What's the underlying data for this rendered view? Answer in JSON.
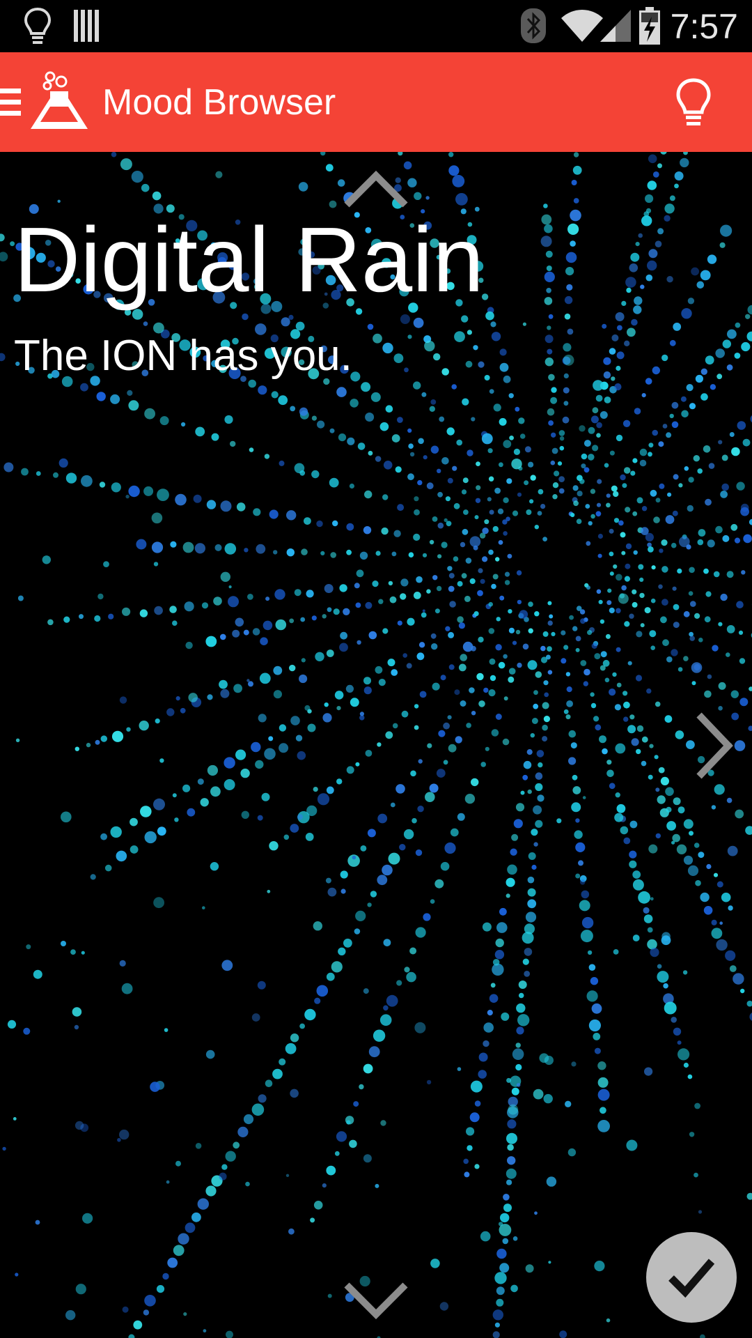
{
  "status_bar": {
    "time": "7:57",
    "icons": [
      "lightbulb-icon",
      "barcode-icon",
      "bluetooth-icon",
      "wifi-icon",
      "signal-icon",
      "battery-charging-icon"
    ]
  },
  "app_bar": {
    "title": "Mood Browser",
    "menu_icon": "hamburger-menu-icon",
    "logo_icon": "flask-logo-icon",
    "action_icon": "lightbulb-icon"
  },
  "mood": {
    "title": "Digital Rain",
    "subtitle": "The ION has you.",
    "background": "cyan-particle-starburst",
    "dot_color": "#22d3e6"
  },
  "navigation": {
    "up_icon": "chevron-up-icon",
    "down_icon": "chevron-down-icon",
    "next_icon": "chevron-right-icon"
  },
  "confirm": {
    "icon": "checkmark-icon",
    "color": "#bdbdbd"
  },
  "colors": {
    "app_bar": "#f44336",
    "background": "#000000"
  }
}
